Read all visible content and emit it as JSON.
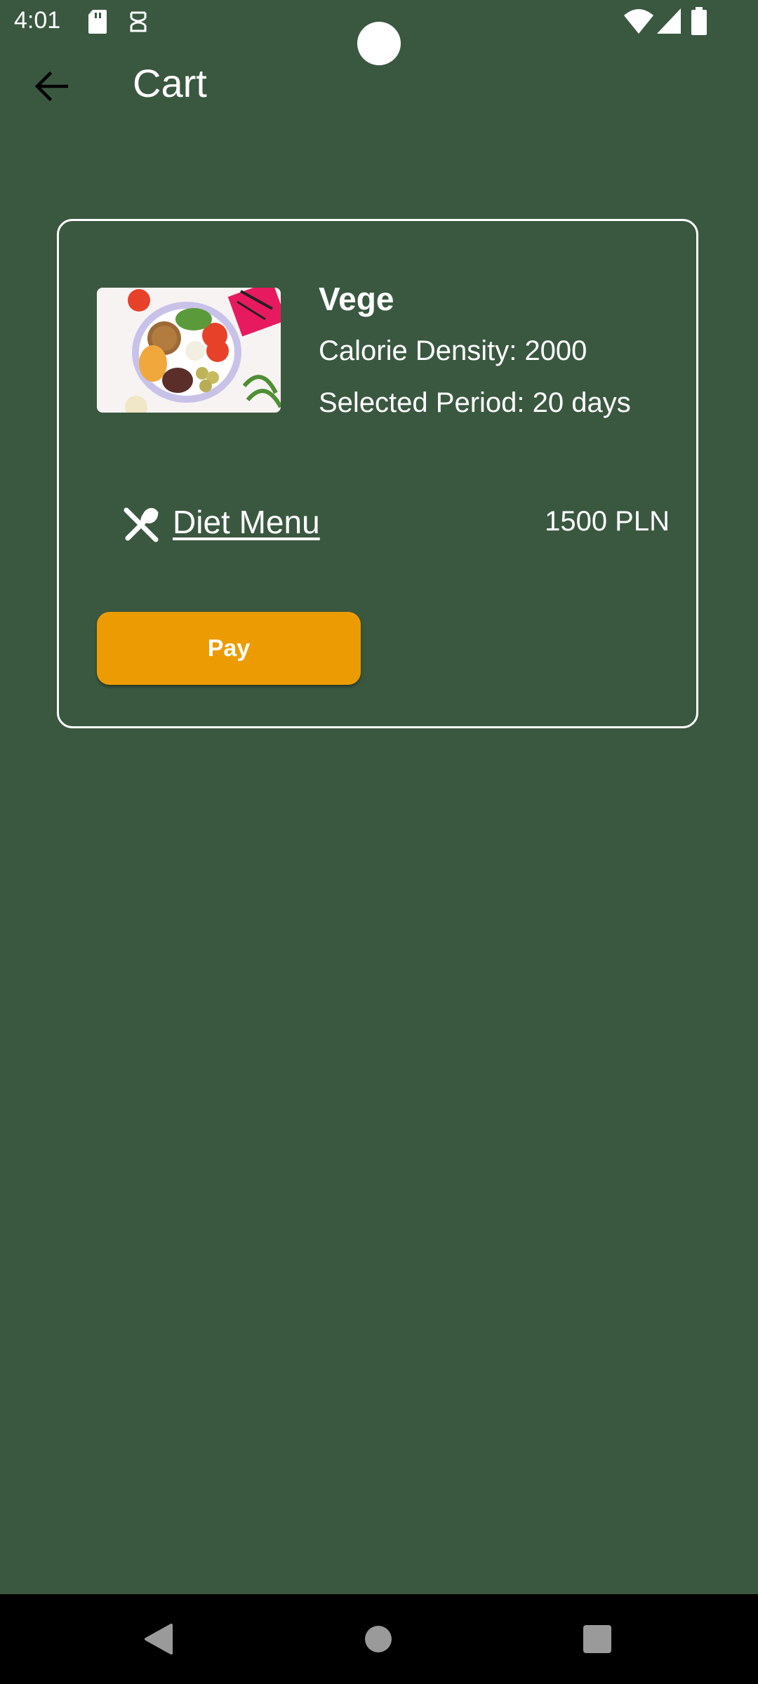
{
  "status_bar": {
    "time": "4:01",
    "left_icons": [
      "sd-card-icon",
      "sim-toolkit-icon"
    ],
    "right_icons": [
      "wifi-icon",
      "signal-icon",
      "battery-icon"
    ]
  },
  "app_bar": {
    "title": "Cart",
    "back_icon": "arrow-left-icon"
  },
  "cart_item": {
    "name": "Vege",
    "calorie_density": "Calorie Density: 2000",
    "selected_period": "Selected Period: 20 days",
    "image_description_icon": "food-plate-image",
    "menu_icon": "cutlery-icon",
    "menu_link": "Diet Menu",
    "price": "1500 PLN",
    "pay_label": "Pay"
  },
  "colors": {
    "background": "#3a5840",
    "accent": "#ec9c02",
    "text": "#ffffff"
  }
}
